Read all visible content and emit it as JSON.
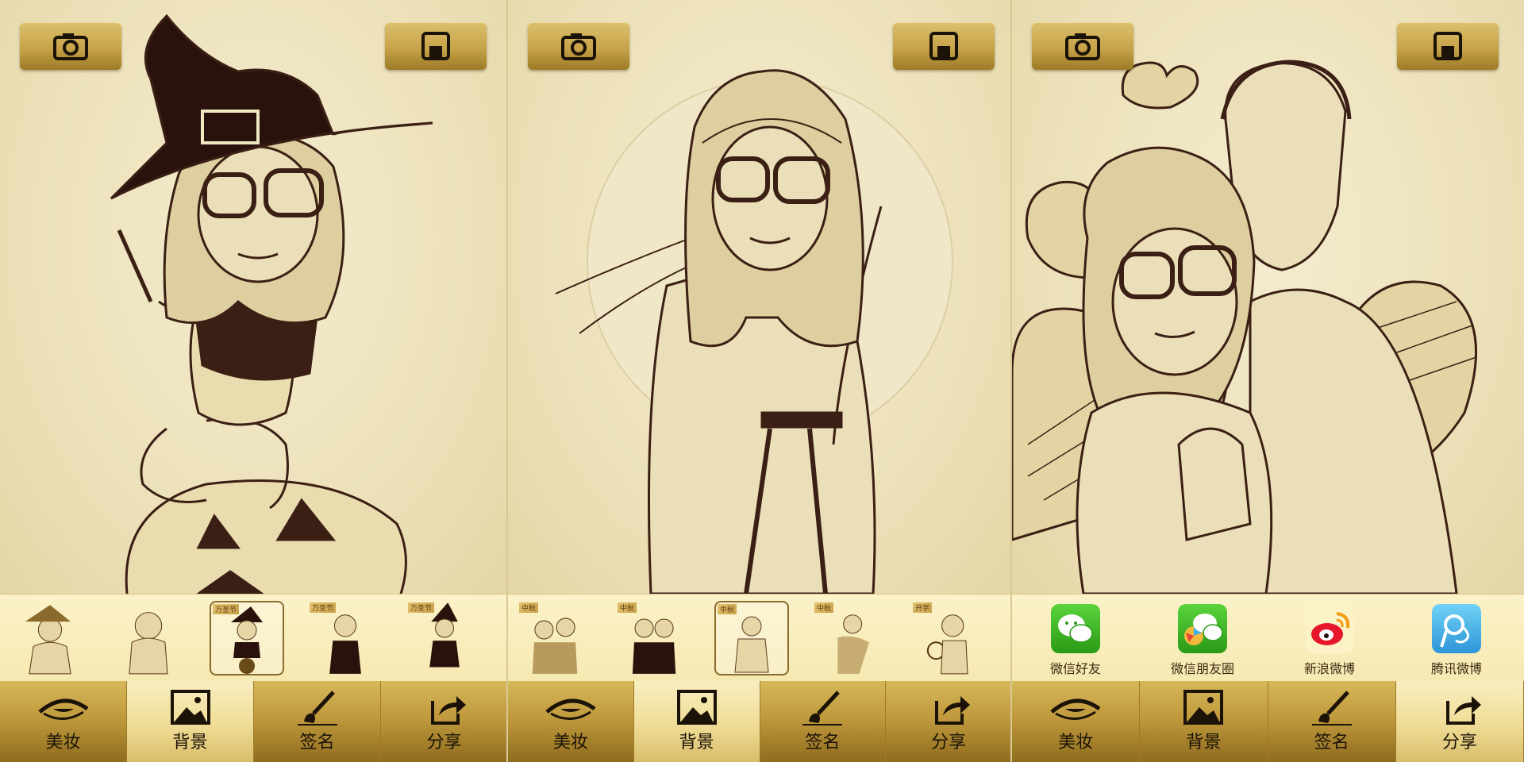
{
  "screens": [
    {
      "id": "makeup-halloween",
      "thumbnails": [
        {
          "badge": "",
          "selected": false
        },
        {
          "badge": "",
          "selected": false
        },
        {
          "badge": "万圣节",
          "selected": true
        },
        {
          "badge": "万圣节",
          "selected": false
        },
        {
          "badge": "万圣节",
          "selected": false
        }
      ],
      "active_tab": "background"
    },
    {
      "id": "mid-autumn",
      "thumbnails": [
        {
          "badge": "中秋",
          "selected": false
        },
        {
          "badge": "中秋",
          "selected": false
        },
        {
          "badge": "中秋",
          "selected": true
        },
        {
          "badge": "中秋",
          "selected": false
        },
        {
          "badge": "开学",
          "selected": false
        }
      ],
      "active_tab": "background"
    },
    {
      "id": "share",
      "share_targets": [
        {
          "label": "微信好友",
          "icon": "wechat-icon"
        },
        {
          "label": "微信朋友圈",
          "icon": "wechat-moments-icon"
        },
        {
          "label": "新浪微博",
          "icon": "weibo-icon"
        },
        {
          "label": "腾讯微博",
          "icon": "tencent-weibo-icon"
        }
      ],
      "active_tab": "share"
    }
  ],
  "tabs": {
    "makeup": "美妆",
    "background": "背景",
    "signature": "签名",
    "share": "分享"
  },
  "icons": {
    "camera": "camera-icon",
    "save": "save-icon"
  },
  "colors": {
    "sepia": "#3b1f14",
    "gold": "#c7a349",
    "active_tab": "#efdc95"
  }
}
